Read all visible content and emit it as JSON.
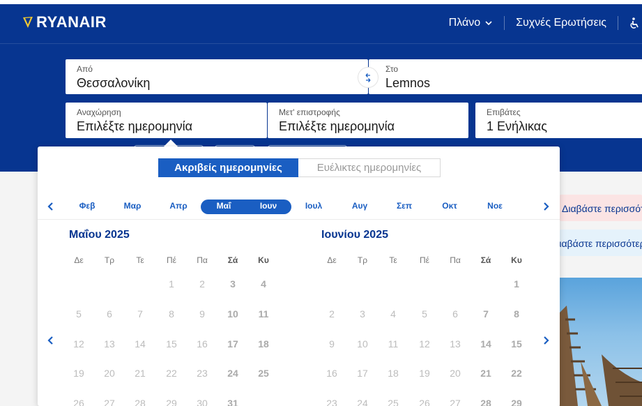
{
  "header": {
    "brand": "RYANAIR",
    "nav": [
      {
        "label": "Πλάνο",
        "has_chevron": true
      },
      {
        "label": "Συχνές Ερωτήσεις",
        "has_chevron": false
      },
      {
        "label": "accessibility-icon",
        "icon": true
      }
    ]
  },
  "search": {
    "from": {
      "label": "Από",
      "value": "Θεσσαλονίκη"
    },
    "to": {
      "label": "Στο",
      "value": "Lemnos"
    },
    "departure": {
      "label": "Αναχώρηση",
      "value": "Επιλέξτε ημερομηνία"
    },
    "return": {
      "label": "Μετ' επιστροφής",
      "value": "Επιλέξτε ημερομηνία"
    },
    "passengers": {
      "label": "Επιβάτες",
      "value": "1 Ενήλικας"
    }
  },
  "calendar": {
    "mode_tabs": [
      {
        "label": "Ακριβείς ημερομηνίες",
        "active": true
      },
      {
        "label": "Ευέλικτες ημερομηνίες",
        "active": false
      }
    ],
    "month_strip": [
      "Φεβ",
      "Μαρ",
      "Απρ",
      "Μαΐ",
      "Ιουν",
      "Ιουλ",
      "Αυγ",
      "Σεπ",
      "Οκτ",
      "Νοε"
    ],
    "selected_months": [
      "Μαΐ",
      "Ιουν"
    ],
    "weekdays": [
      "Δε",
      "Τρ",
      "Τε",
      "Πέ",
      "Πα",
      "Σά",
      "Κυ"
    ],
    "left": {
      "title": "Μαΐου 2025",
      "rows": [
        [
          "",
          "",
          "",
          "1",
          "2",
          "3",
          "4"
        ],
        [
          "5",
          "6",
          "7",
          "8",
          "9",
          "10",
          "11"
        ],
        [
          "12",
          "13",
          "14",
          "15",
          "16",
          "17",
          "18"
        ],
        [
          "19",
          "20",
          "21",
          "22",
          "23",
          "24",
          "25"
        ],
        [
          "26",
          "27",
          "28",
          "29",
          "30",
          "31",
          ""
        ]
      ]
    },
    "right": {
      "title": "Ιουνίου 2025",
      "rows": [
        [
          "",
          "",
          "",
          "",
          "",
          "",
          "1"
        ],
        [
          "2",
          "3",
          "4",
          "5",
          "6",
          "7",
          "8"
        ],
        [
          "9",
          "10",
          "11",
          "12",
          "13",
          "14",
          "15"
        ],
        [
          "16",
          "17",
          "18",
          "19",
          "20",
          "21",
          "22"
        ],
        [
          "23",
          "24",
          "25",
          "26",
          "27",
          "28",
          "29"
        ]
      ]
    }
  },
  "promos": {
    "promo1": "Διαβάστε περισσότερα",
    "promo2": "Διαβάστε περισσότερα"
  },
  "colors": {
    "brand_blue": "#073590",
    "accent_blue": "#1a5ec2",
    "promo_pink": "#fbe4e4",
    "promo_blue": "#e5f2fb"
  }
}
